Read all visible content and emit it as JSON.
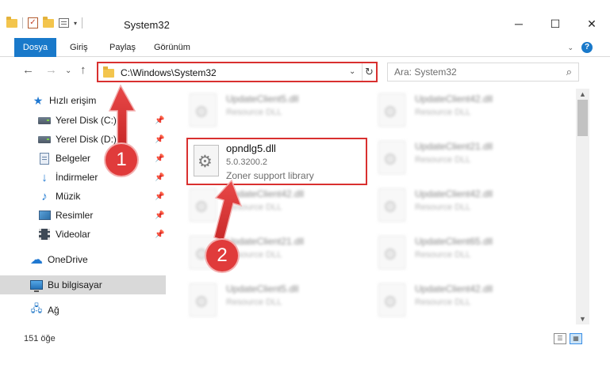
{
  "window": {
    "title": "System32",
    "minimize": "─",
    "maximize": "☐",
    "close": "✕"
  },
  "quick_access_toolbar": {
    "dropdown": "▾"
  },
  "ribbon": {
    "tabs": [
      "Dosya",
      "Giriş",
      "Paylaş",
      "Görünüm"
    ],
    "expand_chevron": "⌄",
    "help": "?"
  },
  "nav": {
    "back": "←",
    "forward": "→",
    "recent": "⌄",
    "up": "↑"
  },
  "address_bar": {
    "path": "C:\\Windows\\System32",
    "dropdown": "⌄",
    "refresh": "↻"
  },
  "search": {
    "placeholder": "Ara: System32",
    "icon": "⌕"
  },
  "sidebar": {
    "items": [
      {
        "label": "Hızlı erişim",
        "icon": "star-icon"
      },
      {
        "label": "Yerel Disk (C:)",
        "icon": "drive-icon",
        "pinned": true
      },
      {
        "label": "Yerel Disk (D:)",
        "icon": "drive-icon",
        "pinned": true
      },
      {
        "label": "Belgeler",
        "icon": "documents-icon",
        "pinned": true
      },
      {
        "label": "İndirmeler",
        "icon": "download-icon",
        "pinned": true
      },
      {
        "label": "Müzik",
        "icon": "music-icon",
        "pinned": true
      },
      {
        "label": "Resimler",
        "icon": "pictures-icon",
        "pinned": true
      },
      {
        "label": "Videolar",
        "icon": "videos-icon",
        "pinned": true
      },
      {
        "label": "OneDrive",
        "icon": "cloud-icon"
      },
      {
        "label": "Bu bilgisayar",
        "icon": "computer-icon",
        "selected": true
      },
      {
        "label": "Ağ",
        "icon": "network-icon"
      }
    ],
    "pin_glyph": "📌"
  },
  "files": {
    "highlighted": {
      "name": "opndlg5.dll",
      "version": "5.0.3200.2",
      "description": "Zoner support library"
    },
    "background": [
      {
        "name": "UpdateClient5.dll",
        "description": "Resource DLL"
      },
      {
        "name": "UpdateClient42.dll",
        "description": "Resource DLL"
      },
      {
        "name": "UpdateClient21.dll",
        "description": "Resource DLL"
      },
      {
        "name": "UpdateClient42.dll",
        "description": "Resource DLL"
      },
      {
        "name": "UpdateClient42.dll",
        "description": "Resource DLL"
      },
      {
        "name": "UpdateClient21.dll",
        "description": "Resource DLL"
      },
      {
        "name": "UpdateClient65.dll",
        "description": "Resource DLL"
      },
      {
        "name": "UpdateClient5.dll",
        "description": "Resource DLL"
      },
      {
        "name": "UpdateClient42.dll",
        "description": "Resource DLL"
      }
    ]
  },
  "annotations": {
    "step1": "1",
    "step2": "2",
    "color": "#e03b3b"
  },
  "status_bar": {
    "item_count": "151 öğe",
    "view_details": "☰",
    "view_tiles": "▦"
  }
}
